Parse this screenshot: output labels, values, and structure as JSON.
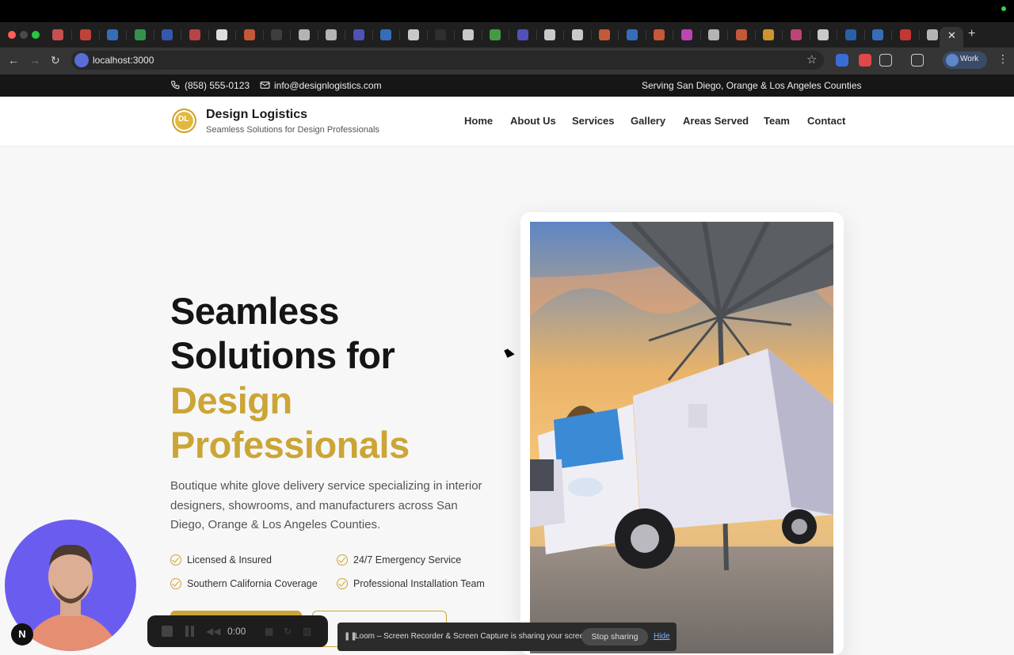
{
  "browser": {
    "url": "localhost:3000",
    "profile_label": "Work",
    "tab_close": "✕",
    "tab_new": "+"
  },
  "topbar": {
    "phone": "(858) 555-0123",
    "email": "info@designlogistics.com",
    "service_area": "Serving San Diego, Orange & Los Angeles Counties"
  },
  "header": {
    "brand": "Design Logistics",
    "tagline": "Seamless Solutions for Design Professionals",
    "logo_text": "DL",
    "nav": [
      "Home",
      "About Us",
      "Services",
      "Gallery",
      "Areas Served",
      "Team",
      "Contact"
    ]
  },
  "hero": {
    "title_line1": "Seamless",
    "title_line2": "Solutions for",
    "title_line3": "Design",
    "title_line4": "Professionals",
    "subtitle": "Boutique white glove delivery service specializing in interior designers, showrooms, and manufacturers across San Diego, Orange & Los Angeles Counties.",
    "features": [
      "Licensed & Insured",
      "24/7 Emergency Service",
      "Southern California Coverage",
      "Professional Installation Team"
    ],
    "accent_color": "#cba536"
  },
  "recorder": {
    "timer": "0:00",
    "badge": "N",
    "share_message": "Loom – Screen Recorder & Screen Capture is sharing your screen.",
    "stop_label": "Stop sharing",
    "hide_label": "Hide"
  }
}
